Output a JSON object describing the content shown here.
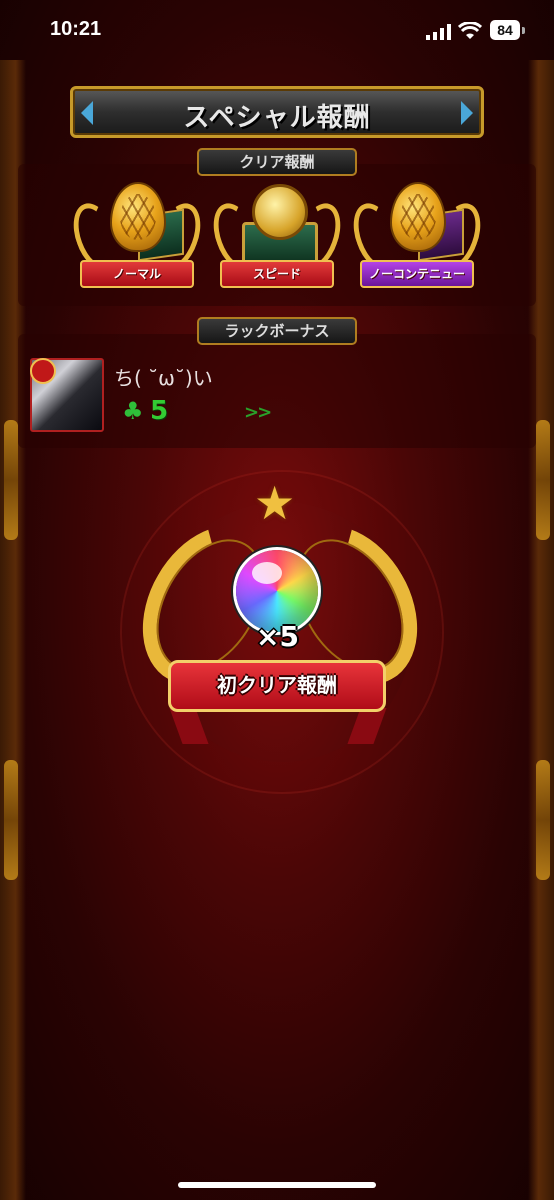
{
  "status_bar": {
    "time": "10:21",
    "battery": "84"
  },
  "header": {
    "title": "スペシャル報酬"
  },
  "clear_rewards": {
    "label": "クリア報酬",
    "items": [
      {
        "label": "ノーマル",
        "icon": "egg-icon"
      },
      {
        "label": "スピード",
        "icon": "treasure-chest-icon"
      },
      {
        "label": "ノーコンテニュー",
        "icon": "egg-icon"
      }
    ]
  },
  "luck_bonus": {
    "label": "ラックボーナス",
    "player_name": "ち( ˘ω˘)い",
    "luck": "5",
    "arrow": ">>"
  },
  "first_clear": {
    "multiplier": "×5",
    "label": "初クリア報酬",
    "icon": "orb-icon"
  }
}
